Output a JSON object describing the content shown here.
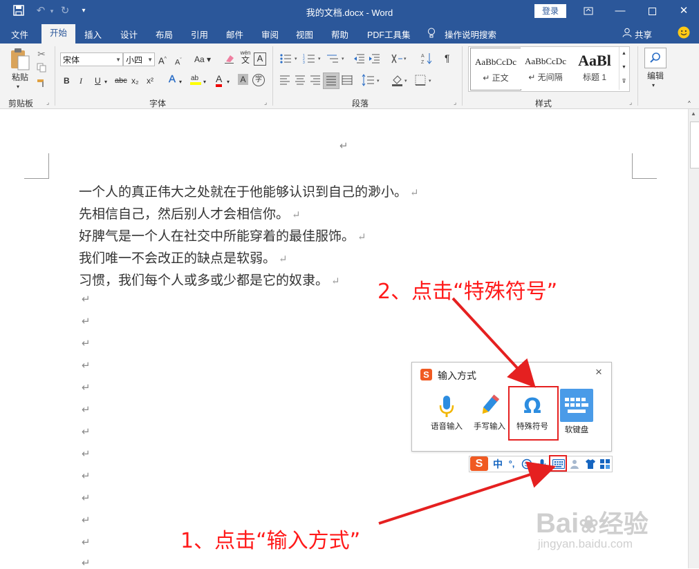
{
  "app": {
    "title": "我的文档.docx  -  Word",
    "login": "登录",
    "share": "共享"
  },
  "tabs": [
    "文件",
    "开始",
    "插入",
    "设计",
    "布局",
    "引用",
    "邮件",
    "审阅",
    "视图",
    "帮助",
    "PDF工具集",
    "操作说明搜索"
  ],
  "ribbon": {
    "clipboard": {
      "paste": "粘贴",
      "label": "剪贴板"
    },
    "font": {
      "font_name": "宋体",
      "font_size": "小四",
      "label": "字体",
      "buttons": [
        "B",
        "I",
        "U",
        "abc",
        "x₂",
        "x²",
        "A",
        "A",
        "A",
        "字"
      ],
      "wen": "wén",
      "wen_char": "文",
      "char_border": "A"
    },
    "paragraph": {
      "label": "段落"
    },
    "styles": {
      "label": "样式",
      "items": [
        {
          "sample": "AaBbCcDc",
          "name": "↵ 正文"
        },
        {
          "sample": "AaBbCcDc",
          "name": "↵ 无间隔"
        },
        {
          "sample": "AaBl",
          "name": "标题 1"
        }
      ]
    },
    "editing": {
      "label": "编辑"
    }
  },
  "document": {
    "lines": [
      "一个人的真正伟大之处就在于他能够认识到自己的渺小。",
      "先相信自己，然后别人才会相信你。",
      "好脾气是一个人在社交中所能穿着的最佳服饰。",
      "我们唯一不会改正的缺点是软弱。",
      "习惯，我们每个人或多或少都是它的奴隶。"
    ],
    "para_mark": "↵"
  },
  "ime": {
    "panel_title": "输入方式",
    "close": "×",
    "options": [
      "语音输入",
      "手写输入",
      "特殊符号",
      "软键盘"
    ],
    "status_zh": "中",
    "status_punct": "°,"
  },
  "annotations": {
    "step1": "1、点击“输入方式”",
    "step2": "2、点击“特殊符号”"
  },
  "watermark": {
    "brand": "Bai",
    "brand2": "经验",
    "url": "jingyan.baidu.com"
  },
  "colors": {
    "brand_blue": "#2b579a",
    "annotation_red": "#e52020",
    "sogou_orange": "#f05a22"
  }
}
